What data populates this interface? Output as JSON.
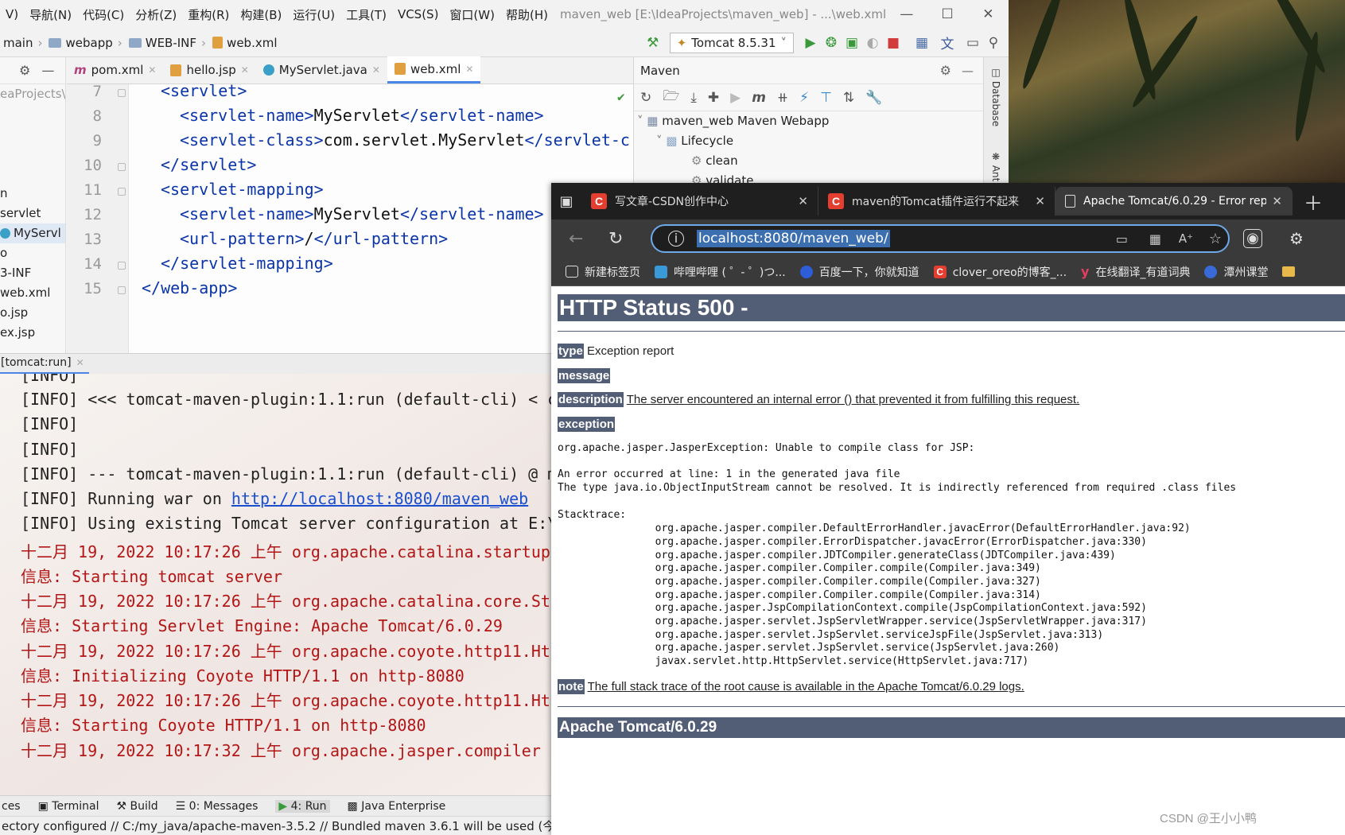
{
  "menu": {
    "items": [
      "V)",
      "导航(N)",
      "代码(C)",
      "分析(Z)",
      "重构(R)",
      "构建(B)",
      "运行(U)",
      "工具(T)",
      "VCS(S)",
      "窗口(W)",
      "帮助(H)"
    ],
    "window_title": "maven_web [E:\\IdeaProjects\\maven_web] - ...\\web.xml"
  },
  "breadcrumb": [
    "main",
    "webapp",
    "WEB-INF",
    "web.xml"
  ],
  "run_config": "Tomcat 8.5.31",
  "project_panel": {
    "rows": [
      "eaProjects\\",
      "",
      "",
      "",
      "",
      "n",
      "servlet",
      "MyServl",
      "o",
      "3-INF",
      "web.xml",
      "o.jsp",
      "ex.jsp"
    ]
  },
  "editor_tabs": [
    "pom.xml",
    "hello.jsp",
    "MyServlet.java",
    "web.xml"
  ],
  "code": {
    "line_numbers": [
      "7",
      "8",
      "9",
      "10",
      "11",
      "12",
      "13",
      "14",
      "15"
    ],
    "l7": "<servlet>",
    "l8_open": "<servlet-name>",
    "l8_text": "MyServlet",
    "l8_close": "</servlet-name>",
    "l9_open": "<servlet-class>",
    "l9_text": "com.servlet.MyServlet",
    "l9_close": "</servlet-c",
    "l10": "</servlet>",
    "l11": "<servlet-mapping>",
    "l12_open": "<servlet-name>",
    "l12_text": "MyServlet",
    "l12_close": "</servlet-name>",
    "l13_open": "<url-pattern>",
    "l13_text": "/",
    "l13_close": "</url-pattern>",
    "l14": "</servlet-mapping>",
    "l15": "</web-app>"
  },
  "maven": {
    "title": "Maven",
    "project": "maven_web Maven Webapp",
    "lifecycle": "Lifecycle",
    "clean": "clean",
    "validate": "validate"
  },
  "side_strip": {
    "database": "Database",
    "ant": "Ant"
  },
  "run_tab": "[tomcat:run]",
  "console": {
    "l0": "[INFO]",
    "l1": "[INFO] <<< tomcat-maven-plugin:1.1:run (default-cli) < c",
    "l2": "[INFO]",
    "l3": "[INFO]",
    "l4": "[INFO] --- tomcat-maven-plugin:1.1:run (default-cli) @ m",
    "l5_pre": "[INFO] Running war on ",
    "l5_link": "http://localhost:8080/maven_web",
    "l6": "[INFO] Using existing Tomcat server configuration at E:\\",
    "l7": "十二月 19, 2022 10:17:26 上午 org.apache.catalina.startup",
    "l8": "信息: Starting tomcat server",
    "l9": "十二月 19, 2022 10:17:26 上午 org.apache.catalina.core.St",
    "l10": "信息: Starting Servlet Engine: Apache Tomcat/6.0.29",
    "l11": "十二月 19, 2022 10:17:26 上午 org.apache.coyote.http11.Ht",
    "l12": "信息: Initializing Coyote HTTP/1.1 on http-8080",
    "l13": "十二月 19, 2022 10:17:26 上午 org.apache.coyote.http11.Ht",
    "l14": "信息: Starting Coyote HTTP/1.1 on http-8080",
    "l15": "十二月 19, 2022 10:17:32 上午 org.apache.jasper.compiler"
  },
  "bottom_tabs": [
    "ces",
    "Terminal",
    "Build",
    "0: Messages",
    "4: Run",
    "Java Enterprise"
  ],
  "status_text": "ectory configured // C:/my_java/apache-maven-3.5.2 // Bundled maven 3.6.1 will be used (今天 9",
  "browser": {
    "tabs": [
      "写文章-CSDN创作中心",
      "maven的Tomcat插件运行不起来",
      "Apache Tomcat/6.0.29 - Error rep"
    ],
    "url": "localhost:8080/maven_web/",
    "favorites": [
      "新建标签页",
      "哔哩哔哩 ( ゜- ゜)つ...",
      "百度一下，你就知道",
      "clover_oreo的博客_...",
      "在线翻译_有道词典",
      "潭州课堂"
    ]
  },
  "error_page": {
    "title": "HTTP Status 500 -",
    "type_label": "type",
    "type_value": "Exception report",
    "message_label": "message",
    "description_label": "description",
    "description_value": "The server encountered an internal error () that prevented it from fulfilling this request.",
    "exception_label": "exception",
    "exception_text": "org.apache.jasper.JasperException: Unable to compile class for JSP:",
    "error_line1": "An error occurred at line: 1 in the generated java file",
    "error_line2": "The type java.io.ObjectInputStream cannot be resolved. It is indirectly referenced from required .class files",
    "stack_header": "Stacktrace:",
    "stack": [
      "\torg.apache.jasper.compiler.DefaultErrorHandler.javacError(DefaultErrorHandler.java:92)",
      "\torg.apache.jasper.compiler.ErrorDispatcher.javacError(ErrorDispatcher.java:330)",
      "\torg.apache.jasper.compiler.JDTCompiler.generateClass(JDTCompiler.java:439)",
      "\torg.apache.jasper.compiler.Compiler.compile(Compiler.java:349)",
      "\torg.apache.jasper.compiler.Compiler.compile(Compiler.java:327)",
      "\torg.apache.jasper.compiler.Compiler.compile(Compiler.java:314)",
      "\torg.apache.jasper.JspCompilationContext.compile(JspCompilationContext.java:592)",
      "\torg.apache.jasper.servlet.JspServletWrapper.service(JspServletWrapper.java:317)",
      "\torg.apache.jasper.servlet.JspServlet.serviceJspFile(JspServlet.java:313)",
      "\torg.apache.jasper.servlet.JspServlet.service(JspServlet.java:260)",
      "\tjavax.servlet.http.HttpServlet.service(HttpServlet.java:717)"
    ],
    "note_label": "note",
    "note_value": "The full stack trace of the root cause is available in the Apache Tomcat/6.0.29 logs.",
    "footer": "Apache Tomcat/6.0.29"
  },
  "watermark": "CSDN @王小小鸭",
  "colors": {
    "tomcat_header": "#525d76",
    "xml_tag": "#0a34a8",
    "console_red": "#b21616",
    "link": "#1a4fd0"
  }
}
